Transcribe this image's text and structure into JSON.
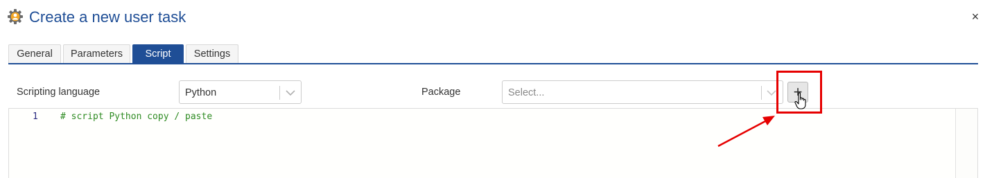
{
  "dialog": {
    "title": "Create a new user task",
    "title_icon": "user-gear-icon",
    "close_label": "×"
  },
  "tabs": [
    {
      "label": "General",
      "active": false
    },
    {
      "label": "Parameters",
      "active": false
    },
    {
      "label": "Script",
      "active": true
    },
    {
      "label": "Settings",
      "active": false
    }
  ],
  "form": {
    "scripting_language_label": "Scripting language",
    "scripting_language_value": "Python",
    "package_label": "Package",
    "package_placeholder": "Select...",
    "add_button_label": "+"
  },
  "editor": {
    "lines": [
      {
        "number": "1",
        "text": "# script Python copy / paste"
      }
    ]
  },
  "colors": {
    "accent": "#1f4e96",
    "annotation": "#e60000",
    "code_comment": "#2e8b22"
  }
}
